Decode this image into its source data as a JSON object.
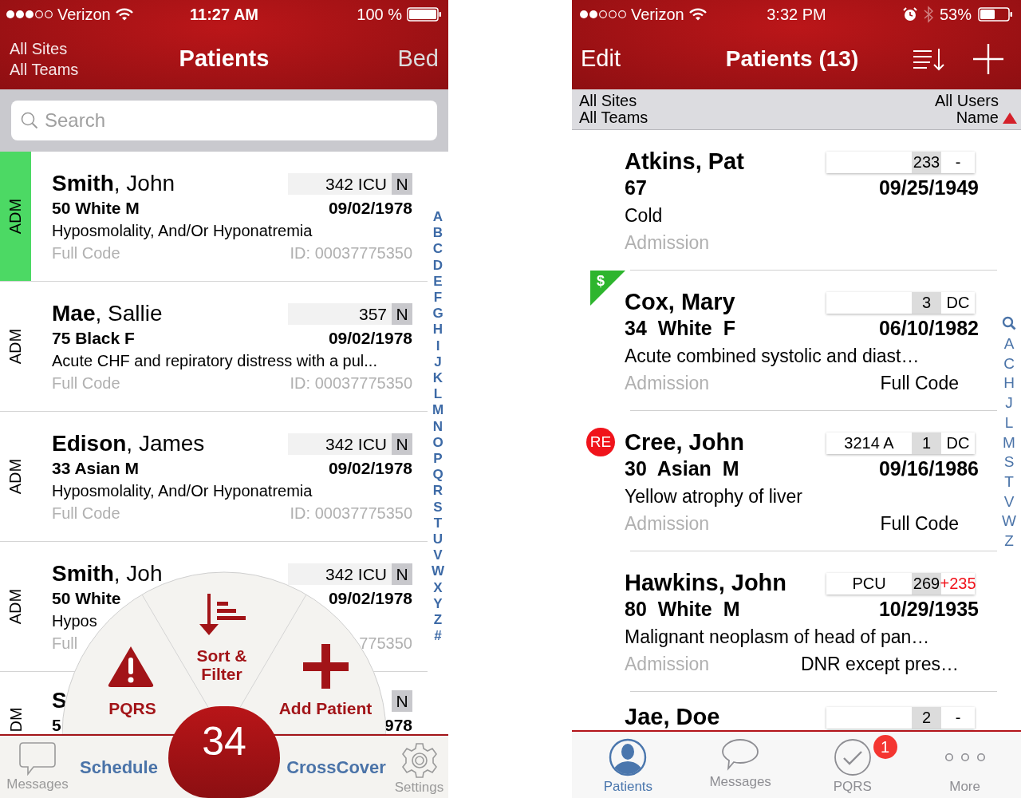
{
  "left_screen": {
    "status_bar": {
      "carrier": "Verizon",
      "time": "11:27 AM",
      "battery": "100 %"
    },
    "nav": {
      "filters": [
        "All Sites",
        "All Teams"
      ],
      "title": "Patients",
      "right_button": "Bed"
    },
    "search": {
      "placeholder": "Search"
    },
    "patients": [
      {
        "status": "ADM",
        "highlighted": true,
        "name": "**Smith**, John",
        "room": "342 ICU",
        "nurse": "N",
        "info": "50 White M",
        "dob": "09/02/1978",
        "diagnosis": "Hyposmolality, And/Or Hyponatremia",
        "code": "Full Code",
        "id": "ID: 00037775350"
      },
      {
        "status": "ADM",
        "highlighted": false,
        "name": "**Mae**, Sallie",
        "room": "357",
        "nurse": "N",
        "info": "75 Black F",
        "dob": "09/02/1978",
        "diagnosis": "Acute CHF and repiratory distress with a pul...",
        "code": "Full Code",
        "id": "ID: 00037775350"
      },
      {
        "status": "ADM",
        "highlighted": false,
        "name": "**Edison**, James",
        "room": "342 ICU",
        "nurse": "N",
        "info": "33 Asian M",
        "dob": "09/02/1978",
        "diagnosis": "Hyposmolality, And/Or Hyponatremia",
        "code": "Full Code",
        "id": "ID: 00037775350"
      },
      {
        "status": "ADM",
        "highlighted": false,
        "name": "**Smith**, Joh",
        "room": "342 ICU",
        "nurse": "N",
        "info": "50 White",
        "dob": "09/02/1978",
        "diagnosis": "Hypos",
        "code": "Full",
        "id": "775350"
      },
      {
        "status": "DM",
        "highlighted": false,
        "name": "**S**",
        "nurse": "N",
        "info": "5",
        "dob": "978"
      }
    ],
    "index_letters": [
      "A",
      "B",
      "C",
      "D",
      "E",
      "F",
      "G",
      "H",
      "I",
      "J",
      "K",
      "L",
      "M",
      "N",
      "O",
      "P",
      "Q",
      "R",
      "S",
      "T",
      "U",
      "V",
      "W",
      "X",
      "Y",
      "Z",
      "#"
    ],
    "quick_menu": [
      {
        "label": "PQRS"
      },
      {
        "label": "Sort & Filter"
      },
      {
        "label": "Add Patient"
      }
    ],
    "tab_bar": [
      {
        "label": "Messages",
        "kind": "icon"
      },
      {
        "label": "Schedule",
        "kind": "text"
      },
      {
        "label": "34",
        "kind": "count"
      },
      {
        "label": "CrossCover",
        "kind": "text"
      },
      {
        "label": "Settings",
        "kind": "icon"
      }
    ]
  },
  "right_screen": {
    "status_bar": {
      "carrier": "Verizon",
      "time": "3:32 PM",
      "battery": "53%"
    },
    "nav": {
      "edit": "Edit",
      "title": "Patients (13)"
    },
    "filter_bar": {
      "left": [
        "All Sites",
        "All Teams"
      ],
      "right": [
        "All Users",
        "Name"
      ]
    },
    "patients": [
      {
        "name": "Atkins, Pat",
        "room": {
          "bed": "233",
          "status": "-",
          "status_alert": false
        },
        "info": "67",
        "dob": "09/25/1949",
        "diagnosis": "Cold",
        "type": "Admission"
      },
      {
        "name": "Cox, Mary",
        "marker": {
          "kind": "corner",
          "label": "$"
        },
        "room": {
          "bed": "3",
          "status": "DC",
          "status_alert": false
        },
        "info": "34  White  F",
        "dob": "06/10/1982",
        "diagnosis": "Acute combined systolic and diast…",
        "type": "Admission",
        "code": "Full Code"
      },
      {
        "name": "Cree, John",
        "marker": {
          "kind": "circle",
          "label": "RE"
        },
        "room": {
          "location": "3214 A",
          "bed": "1",
          "status": "DC",
          "status_alert": false
        },
        "info": "30  Asian  M",
        "dob": "09/16/1986",
        "diagnosis": "Yellow atrophy of liver",
        "type": "Admission",
        "code": "Full Code"
      },
      {
        "name": "Hawkins, John",
        "room": {
          "location": "PCU",
          "bed": "269",
          "status": "+235",
          "status_alert": true
        },
        "info": "80  White  M",
        "dob": "10/29/1935",
        "diagnosis": "Malignant neoplasm of head of pan…",
        "type": "Admission",
        "code": "DNR except pres…"
      },
      {
        "name": "Jae, Doe",
        "room": {
          "bed": "2",
          "status": "-",
          "status_alert": false
        }
      }
    ],
    "index_letters": [
      "A",
      "C",
      "H",
      "J",
      "L",
      "M",
      "S",
      "T",
      "V",
      "W",
      "Z"
    ],
    "tab_bar": [
      {
        "label": "Patients",
        "selected": true
      },
      {
        "label": "Messages",
        "selected": false
      },
      {
        "label": "PQRS",
        "selected": false,
        "badge": "1"
      },
      {
        "label": "More",
        "selected": false
      }
    ]
  }
}
